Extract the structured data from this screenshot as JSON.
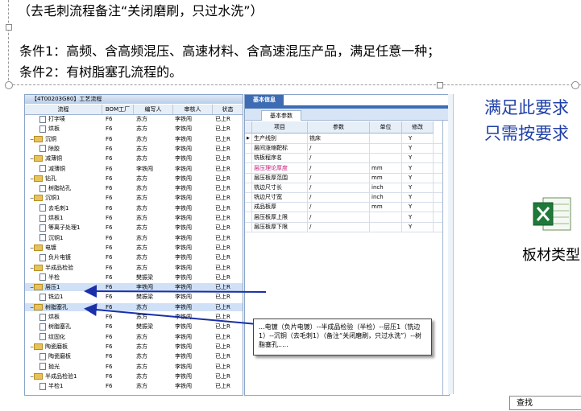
{
  "doc": {
    "line0": "（去毛刺流程备注“关闭磨刷，只过水洗”）",
    "line1": "条件1：高频、含高频混压、高速材料、含高速混压产品，满足任意一种；",
    "line2": "条件2：有树脂塞孔流程的。"
  },
  "left_panel": {
    "title": "【4T00203G80】工艺流程",
    "headers": [
      "流程",
      "BOM工厂",
      "编写人",
      "审核人",
      "状态"
    ],
    "rows": [
      {
        "name": "打字唛",
        "indent": 2,
        "type": "doc",
        "factory": "F6",
        "writer": "苏方",
        "reviewer": "李铁闯",
        "status": "已上R"
      },
      {
        "name": "烘板",
        "indent": 2,
        "type": "doc",
        "factory": "F6",
        "writer": "苏方",
        "reviewer": "李铁闯",
        "status": "已上R"
      },
      {
        "name": "沉铜",
        "indent": 1,
        "type": "folder",
        "factory": "F6",
        "writer": "苏方",
        "reviewer": "李铁闯",
        "status": "已上R"
      },
      {
        "name": "除胶",
        "indent": 2,
        "type": "doc",
        "factory": "F6",
        "writer": "苏方",
        "reviewer": "李铁闯",
        "status": "已上R"
      },
      {
        "name": "减薄铜",
        "indent": 1,
        "type": "folder",
        "factory": "F6",
        "writer": "苏方",
        "reviewer": "李铁闯",
        "status": "已上R"
      },
      {
        "name": "减薄铜",
        "indent": 2,
        "type": "doc",
        "factory": "F6",
        "writer": "李铁闯",
        "reviewer": "李铁闯",
        "status": "已上R"
      },
      {
        "name": "钻孔",
        "indent": 1,
        "type": "folder",
        "factory": "F6",
        "writer": "苏方",
        "reviewer": "李铁闯",
        "status": "已上R"
      },
      {
        "name": "树脂钻孔",
        "indent": 2,
        "type": "doc",
        "factory": "F6",
        "writer": "苏方",
        "reviewer": "李铁闯",
        "status": "已上R"
      },
      {
        "name": "沉铜1",
        "indent": 1,
        "type": "folder",
        "factory": "F6",
        "writer": "苏方",
        "reviewer": "李铁闯",
        "status": "已上R"
      },
      {
        "name": "去毛刺1",
        "indent": 2,
        "type": "doc",
        "factory": "F6",
        "writer": "苏方",
        "reviewer": "李铁闯",
        "status": "已上R"
      },
      {
        "name": "烘板1",
        "indent": 2,
        "type": "doc",
        "factory": "F6",
        "writer": "苏方",
        "reviewer": "李铁闯",
        "status": "已上R"
      },
      {
        "name": "等离子处理1",
        "indent": 2,
        "type": "doc",
        "factory": "F6",
        "writer": "苏方",
        "reviewer": "李铁闯",
        "status": "已上R"
      },
      {
        "name": "沉铜1",
        "indent": 2,
        "type": "doc",
        "factory": "F6",
        "writer": "苏方",
        "reviewer": "李铁闯",
        "status": "已上R"
      },
      {
        "name": "电镀",
        "indent": 1,
        "type": "folder",
        "factory": "F6",
        "writer": "苏方",
        "reviewer": "李铁闯",
        "status": "已上R"
      },
      {
        "name": "负片电镀",
        "indent": 2,
        "type": "doc",
        "factory": "F6",
        "writer": "苏方",
        "reviewer": "李铁闯",
        "status": "已上R"
      },
      {
        "name": "半成品检验",
        "indent": 1,
        "type": "folder",
        "factory": "F6",
        "writer": "苏方",
        "reviewer": "李铁闯",
        "status": "已上R"
      },
      {
        "name": "半检",
        "indent": 2,
        "type": "doc",
        "factory": "F6",
        "writer": "樊振梁",
        "reviewer": "李铁闯",
        "status": "已上R"
      },
      {
        "name": "层压1",
        "indent": 1,
        "type": "folder",
        "factory": "F6",
        "writer": "李铁闯",
        "reviewer": "李铁闯",
        "status": "已上R",
        "highlight": true
      },
      {
        "name": "铣边1",
        "indent": 2,
        "type": "doc",
        "factory": "F6",
        "writer": "樊振梁",
        "reviewer": "李铁闯",
        "status": "已上R"
      },
      {
        "name": "树脂塞孔",
        "indent": 1,
        "type": "folder",
        "factory": "F6",
        "writer": "苏方",
        "reviewer": "李铁闯",
        "status": "已上R",
        "highlight": true
      },
      {
        "name": "烘板",
        "indent": 2,
        "type": "doc",
        "factory": "F6",
        "writer": "苏方",
        "reviewer": "李铁闯",
        "status": "已上R"
      },
      {
        "name": "树脂塞孔",
        "indent": 2,
        "type": "doc",
        "factory": "F6",
        "writer": "樊振梁",
        "reviewer": "李铁闯",
        "status": "已上R"
      },
      {
        "name": "纹固化",
        "indent": 2,
        "type": "doc",
        "factory": "F6",
        "writer": "苏方",
        "reviewer": "李铁闯",
        "status": "已上R"
      },
      {
        "name": "陶瓷磨板",
        "indent": 1,
        "type": "folder",
        "factory": "F6",
        "writer": "苏方",
        "reviewer": "李铁闯",
        "status": "已上R"
      },
      {
        "name": "陶瓷磨板",
        "indent": 2,
        "type": "doc",
        "factory": "F6",
        "writer": "苏方",
        "reviewer": "李铁闯",
        "status": "已上R"
      },
      {
        "name": "抛光",
        "indent": 2,
        "type": "doc",
        "factory": "F6",
        "writer": "苏方",
        "reviewer": "李铁闯",
        "status": "已上R"
      },
      {
        "name": "半成品检验1",
        "indent": 1,
        "type": "folder",
        "factory": "F6",
        "writer": "苏方",
        "reviewer": "李铁闯",
        "status": "已上R"
      },
      {
        "name": "半检1",
        "indent": 2,
        "type": "doc",
        "factory": "F6",
        "writer": "苏方",
        "reviewer": "李铁闯",
        "status": "已上R"
      }
    ]
  },
  "right_panel": {
    "tab": "基本信息",
    "subtab": "基本参数",
    "headers": [
      "项目",
      "参数",
      "单位",
      "修改"
    ],
    "rows": [
      {
        "item": "生产线别",
        "param": "铣床",
        "unit": "",
        "edit": "Y",
        "selected": true
      },
      {
        "item": "层间涨缩靶标",
        "param": "/",
        "unit": "",
        "edit": "Y"
      },
      {
        "item": "铣板程序名",
        "param": "/",
        "unit": "",
        "edit": "Y"
      },
      {
        "item": "层压理论厚度",
        "param": "/",
        "unit": "mm",
        "edit": "Y",
        "pink": true
      },
      {
        "item": "层压板厚范围",
        "param": "/",
        "unit": "mm",
        "edit": "Y"
      },
      {
        "item": "铣边尺寸长",
        "param": "/",
        "unit": "inch",
        "edit": "Y"
      },
      {
        "item": "铣边尺寸宽",
        "param": "/",
        "unit": "inch",
        "edit": "Y"
      },
      {
        "item": "成品板厚",
        "param": "/",
        "unit": "mm",
        "edit": "Y"
      },
      {
        "item": "层压板厚上限",
        "param": "/",
        "unit": "",
        "edit": "Y"
      },
      {
        "item": "层压板厚下限",
        "param": "/",
        "unit": "",
        "edit": "Y"
      }
    ]
  },
  "callout": "...电镀（负片电镀）--半成品检验（半检）--层压1（铣边1）--沉铜（去毛刺1）（备注“关闭磨刷，只过水洗”）--树脂塞孔.....",
  "side": {
    "line1": "满足此要求",
    "line2": "只需按要求",
    "excel_icon": "excel-icon",
    "board_label": "板材类型",
    "search": "查找"
  },
  "colors": {
    "accent": "#3d6cb3",
    "arrow": "#1a2fa8",
    "side_text": "#2040a8",
    "pink": "#c2187a"
  }
}
